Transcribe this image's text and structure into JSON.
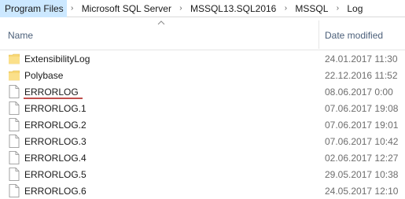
{
  "breadcrumb": [
    {
      "label": "Program Files",
      "highlighted": true
    },
    {
      "label": "Microsoft SQL Server"
    },
    {
      "label": "MSSQL13.SQL2016"
    },
    {
      "label": "MSSQL"
    },
    {
      "label": "Log"
    }
  ],
  "header": {
    "name_label": "Name",
    "date_label": "Date modified",
    "sort_indicator": "chevron-up-icon"
  },
  "files": [
    {
      "name": "ExtensibilityLog",
      "date": "24.01.2017 11:30",
      "type": "folder"
    },
    {
      "name": "Polybase",
      "date": "22.12.2016 11:52",
      "type": "folder"
    },
    {
      "name": "ERRORLOG",
      "date": "08.06.2017 0:00",
      "type": "file",
      "annotated": true
    },
    {
      "name": "ERRORLOG.1",
      "date": "07.06.2017 19:08",
      "type": "file"
    },
    {
      "name": "ERRORLOG.2",
      "date": "07.06.2017 19:01",
      "type": "file"
    },
    {
      "name": "ERRORLOG.3",
      "date": "07.06.2017 10:42",
      "type": "file"
    },
    {
      "name": "ERRORLOG.4",
      "date": "02.06.2017 12:27",
      "type": "file"
    },
    {
      "name": "ERRORLOG.5",
      "date": "29.05.2017 10:38",
      "type": "file"
    },
    {
      "name": "ERRORLOG.6",
      "date": "24.05.2017 12:10",
      "type": "file"
    }
  ],
  "colors": {
    "folder": "#f8d775",
    "highlight": "#cce8ff",
    "annotation": "#c0504d"
  }
}
